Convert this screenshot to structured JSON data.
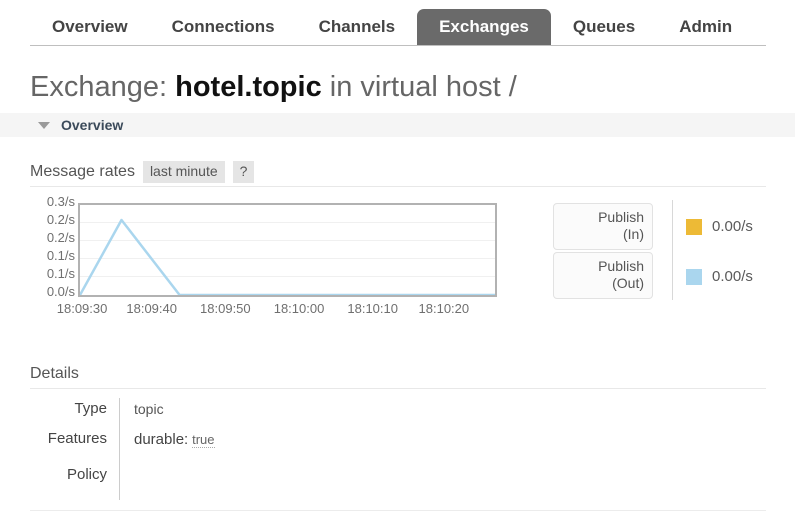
{
  "nav": {
    "tabs": [
      {
        "label": "Overview",
        "active": false
      },
      {
        "label": "Connections",
        "active": false
      },
      {
        "label": "Channels",
        "active": false
      },
      {
        "label": "Exchanges",
        "active": true
      },
      {
        "label": "Queues",
        "active": false
      },
      {
        "label": "Admin",
        "active": false
      }
    ]
  },
  "page": {
    "title_prefix": "Exchange:",
    "title_name": "hotel.topic",
    "title_suffix": "in virtual host",
    "title_vhost": "/"
  },
  "overview_section": {
    "label": "Overview",
    "arrow_icon": "triangle-down-icon"
  },
  "rates": {
    "title": "Message rates",
    "period_label": "last minute",
    "help_label": "?"
  },
  "legend": {
    "buttons": [
      {
        "line1": "Publish",
        "line2": "(In)"
      },
      {
        "line1": "Publish",
        "line2": "(Out)"
      }
    ],
    "items": [
      {
        "name": "Publish (In)",
        "value": "0.00/s",
        "color": "#edba36"
      },
      {
        "name": "Publish (Out)",
        "value": "0.00/s",
        "color": "#aad6ee"
      }
    ]
  },
  "details": {
    "title": "Details",
    "rows": [
      {
        "label": "Type",
        "value": "topic",
        "kind": "text"
      },
      {
        "label": "Features",
        "feature_key": "durable:",
        "feature_value": "true",
        "kind": "feature"
      },
      {
        "label": "Policy",
        "value": "",
        "kind": "text"
      }
    ]
  },
  "chart_data": {
    "type": "line",
    "title": "Message rates",
    "xlabel": "",
    "ylabel": "",
    "ylim": [
      0.0,
      0.3
    ],
    "ytick_labels": [
      "0.3/s",
      "0.2/s",
      "0.2/s",
      "0.1/s",
      "0.1/s",
      "0.0/s"
    ],
    "ytick_values": [
      0.3,
      0.25,
      0.2,
      0.15,
      0.1,
      0.05
    ],
    "xtick_labels": [
      "18:09:30",
      "18:09:40",
      "18:09:50",
      "18:10:00",
      "18:10:10",
      "18:10:20"
    ],
    "grid": true,
    "legend_position": "right",
    "series": [
      {
        "name": "Publish (In)",
        "color": "#edba36",
        "current": "0.00/s",
        "x": [
          "18:09:30",
          "18:09:40",
          "18:09:50",
          "18:10:00",
          "18:10:10",
          "18:10:20"
        ],
        "values": [
          0,
          0,
          0,
          0,
          0,
          0
        ]
      },
      {
        "name": "Publish (Out)",
        "color": "#aad6ee",
        "current": "0.00/s",
        "x": [
          "18:09:30",
          "18:09:35",
          "18:09:42",
          "18:09:50",
          "18:10:00",
          "18:10:10",
          "18:10:20"
        ],
        "values": [
          0.0,
          0.25,
          0.0,
          0.0,
          0.0,
          0.0,
          0.0
        ]
      }
    ]
  }
}
